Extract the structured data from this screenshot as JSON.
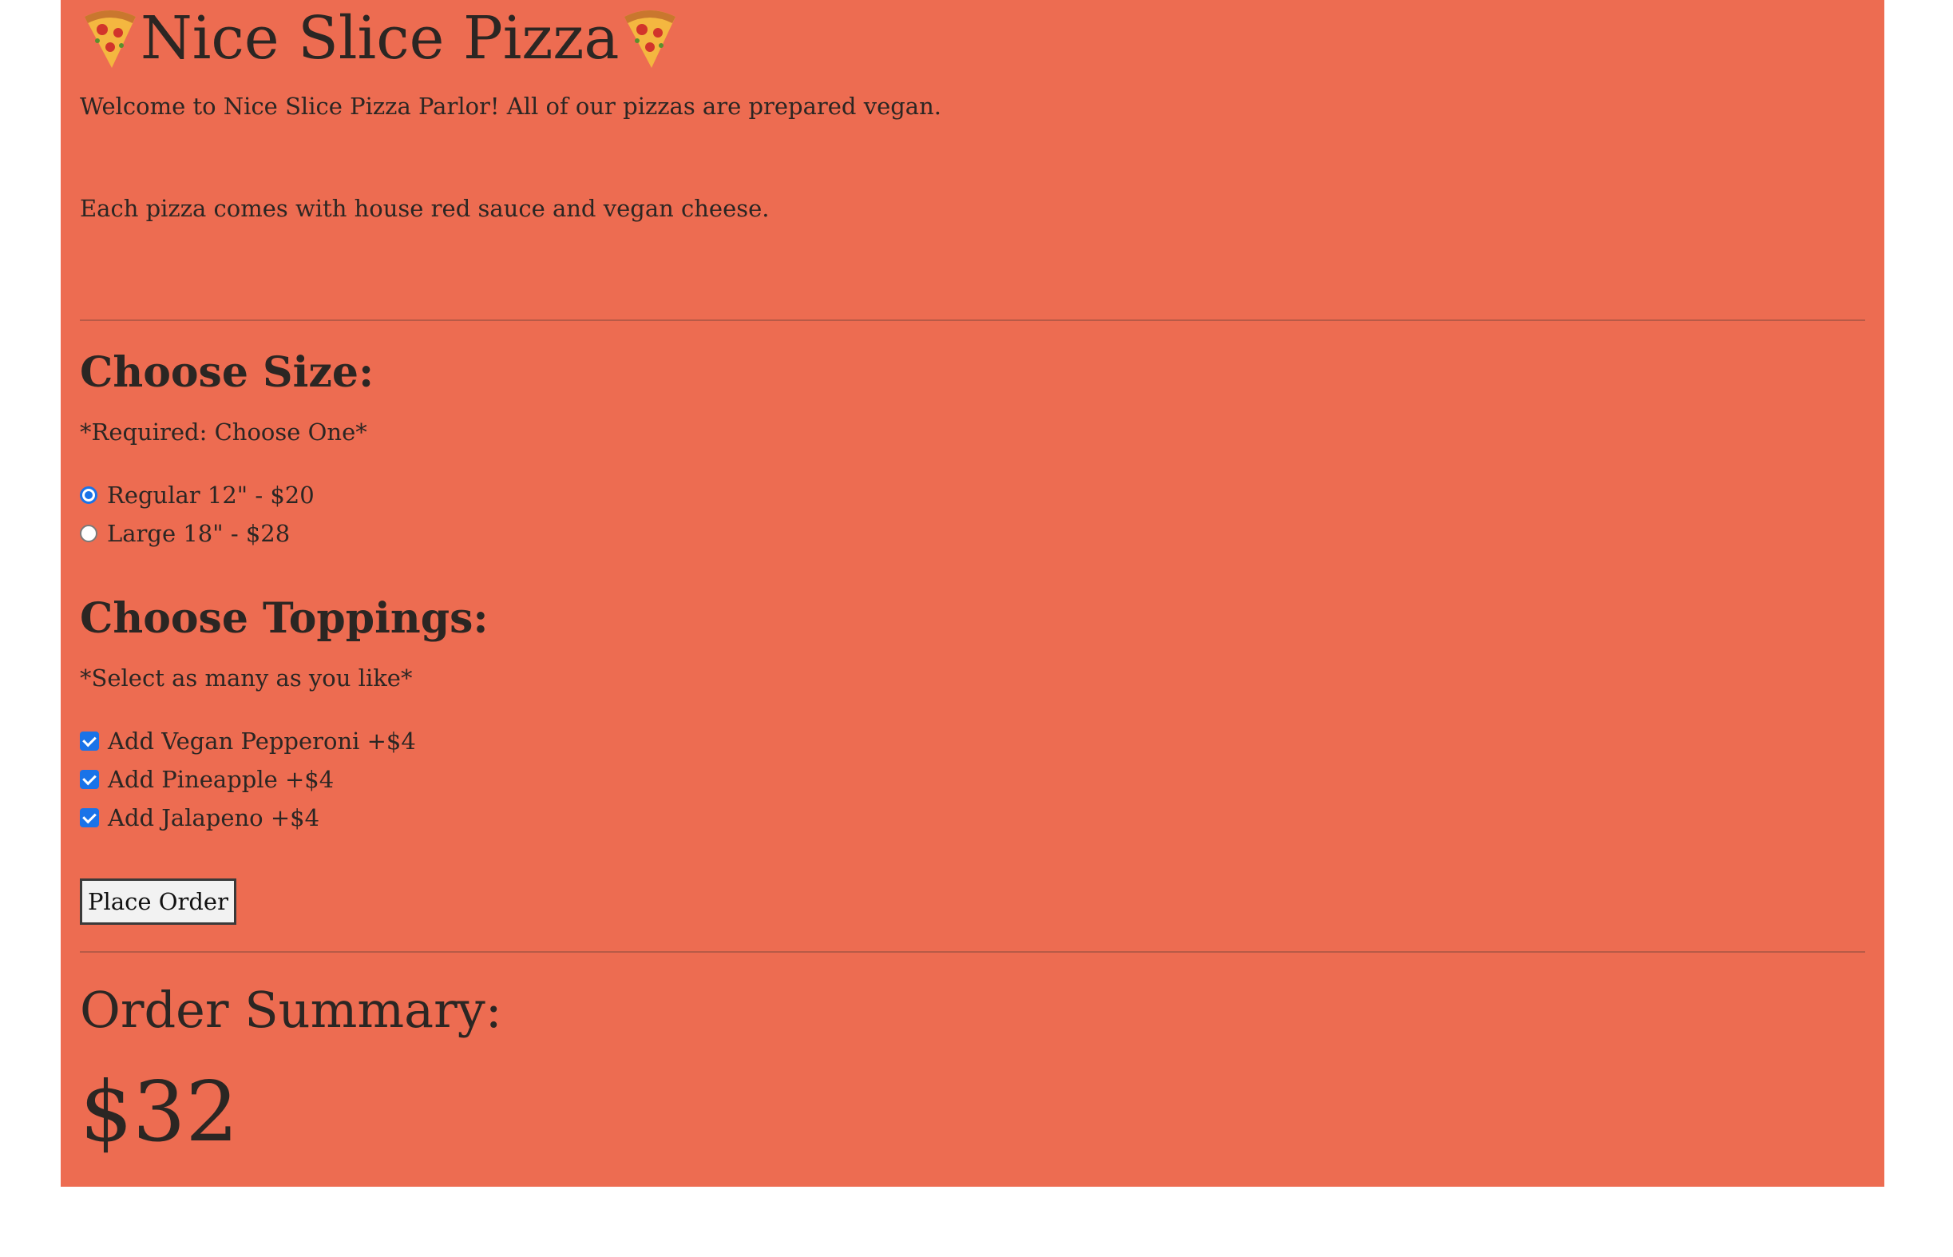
{
  "header": {
    "title": "Nice Slice Pizza",
    "icon": "pizza-slice-icon"
  },
  "intro": {
    "welcome": "Welcome to Nice Slice Pizza Parlor! All of our pizzas are prepared vegan.",
    "description": "Each pizza comes with house red sauce and vegan cheese."
  },
  "size_section": {
    "heading": "Choose Size:",
    "note": "*Required: Choose One*",
    "options": [
      {
        "label": "Regular 12\" - $20",
        "selected": true
      },
      {
        "label": "Large 18\" - $28",
        "selected": false
      }
    ]
  },
  "toppings_section": {
    "heading": "Choose Toppings:",
    "note": "*Select as many as you like*",
    "options": [
      {
        "label": "Add Vegan Pepperoni +$4",
        "checked": true
      },
      {
        "label": "Add Pineapple +$4",
        "checked": true
      },
      {
        "label": "Add Jalapeno +$4",
        "checked": true
      }
    ]
  },
  "actions": {
    "place_order_label": "Place Order"
  },
  "summary": {
    "heading": "Order Summary:",
    "total": "$32"
  },
  "colors": {
    "panel_background": "#ed6c51",
    "text": "#2b2623",
    "control_accent": "#1a73e8"
  }
}
